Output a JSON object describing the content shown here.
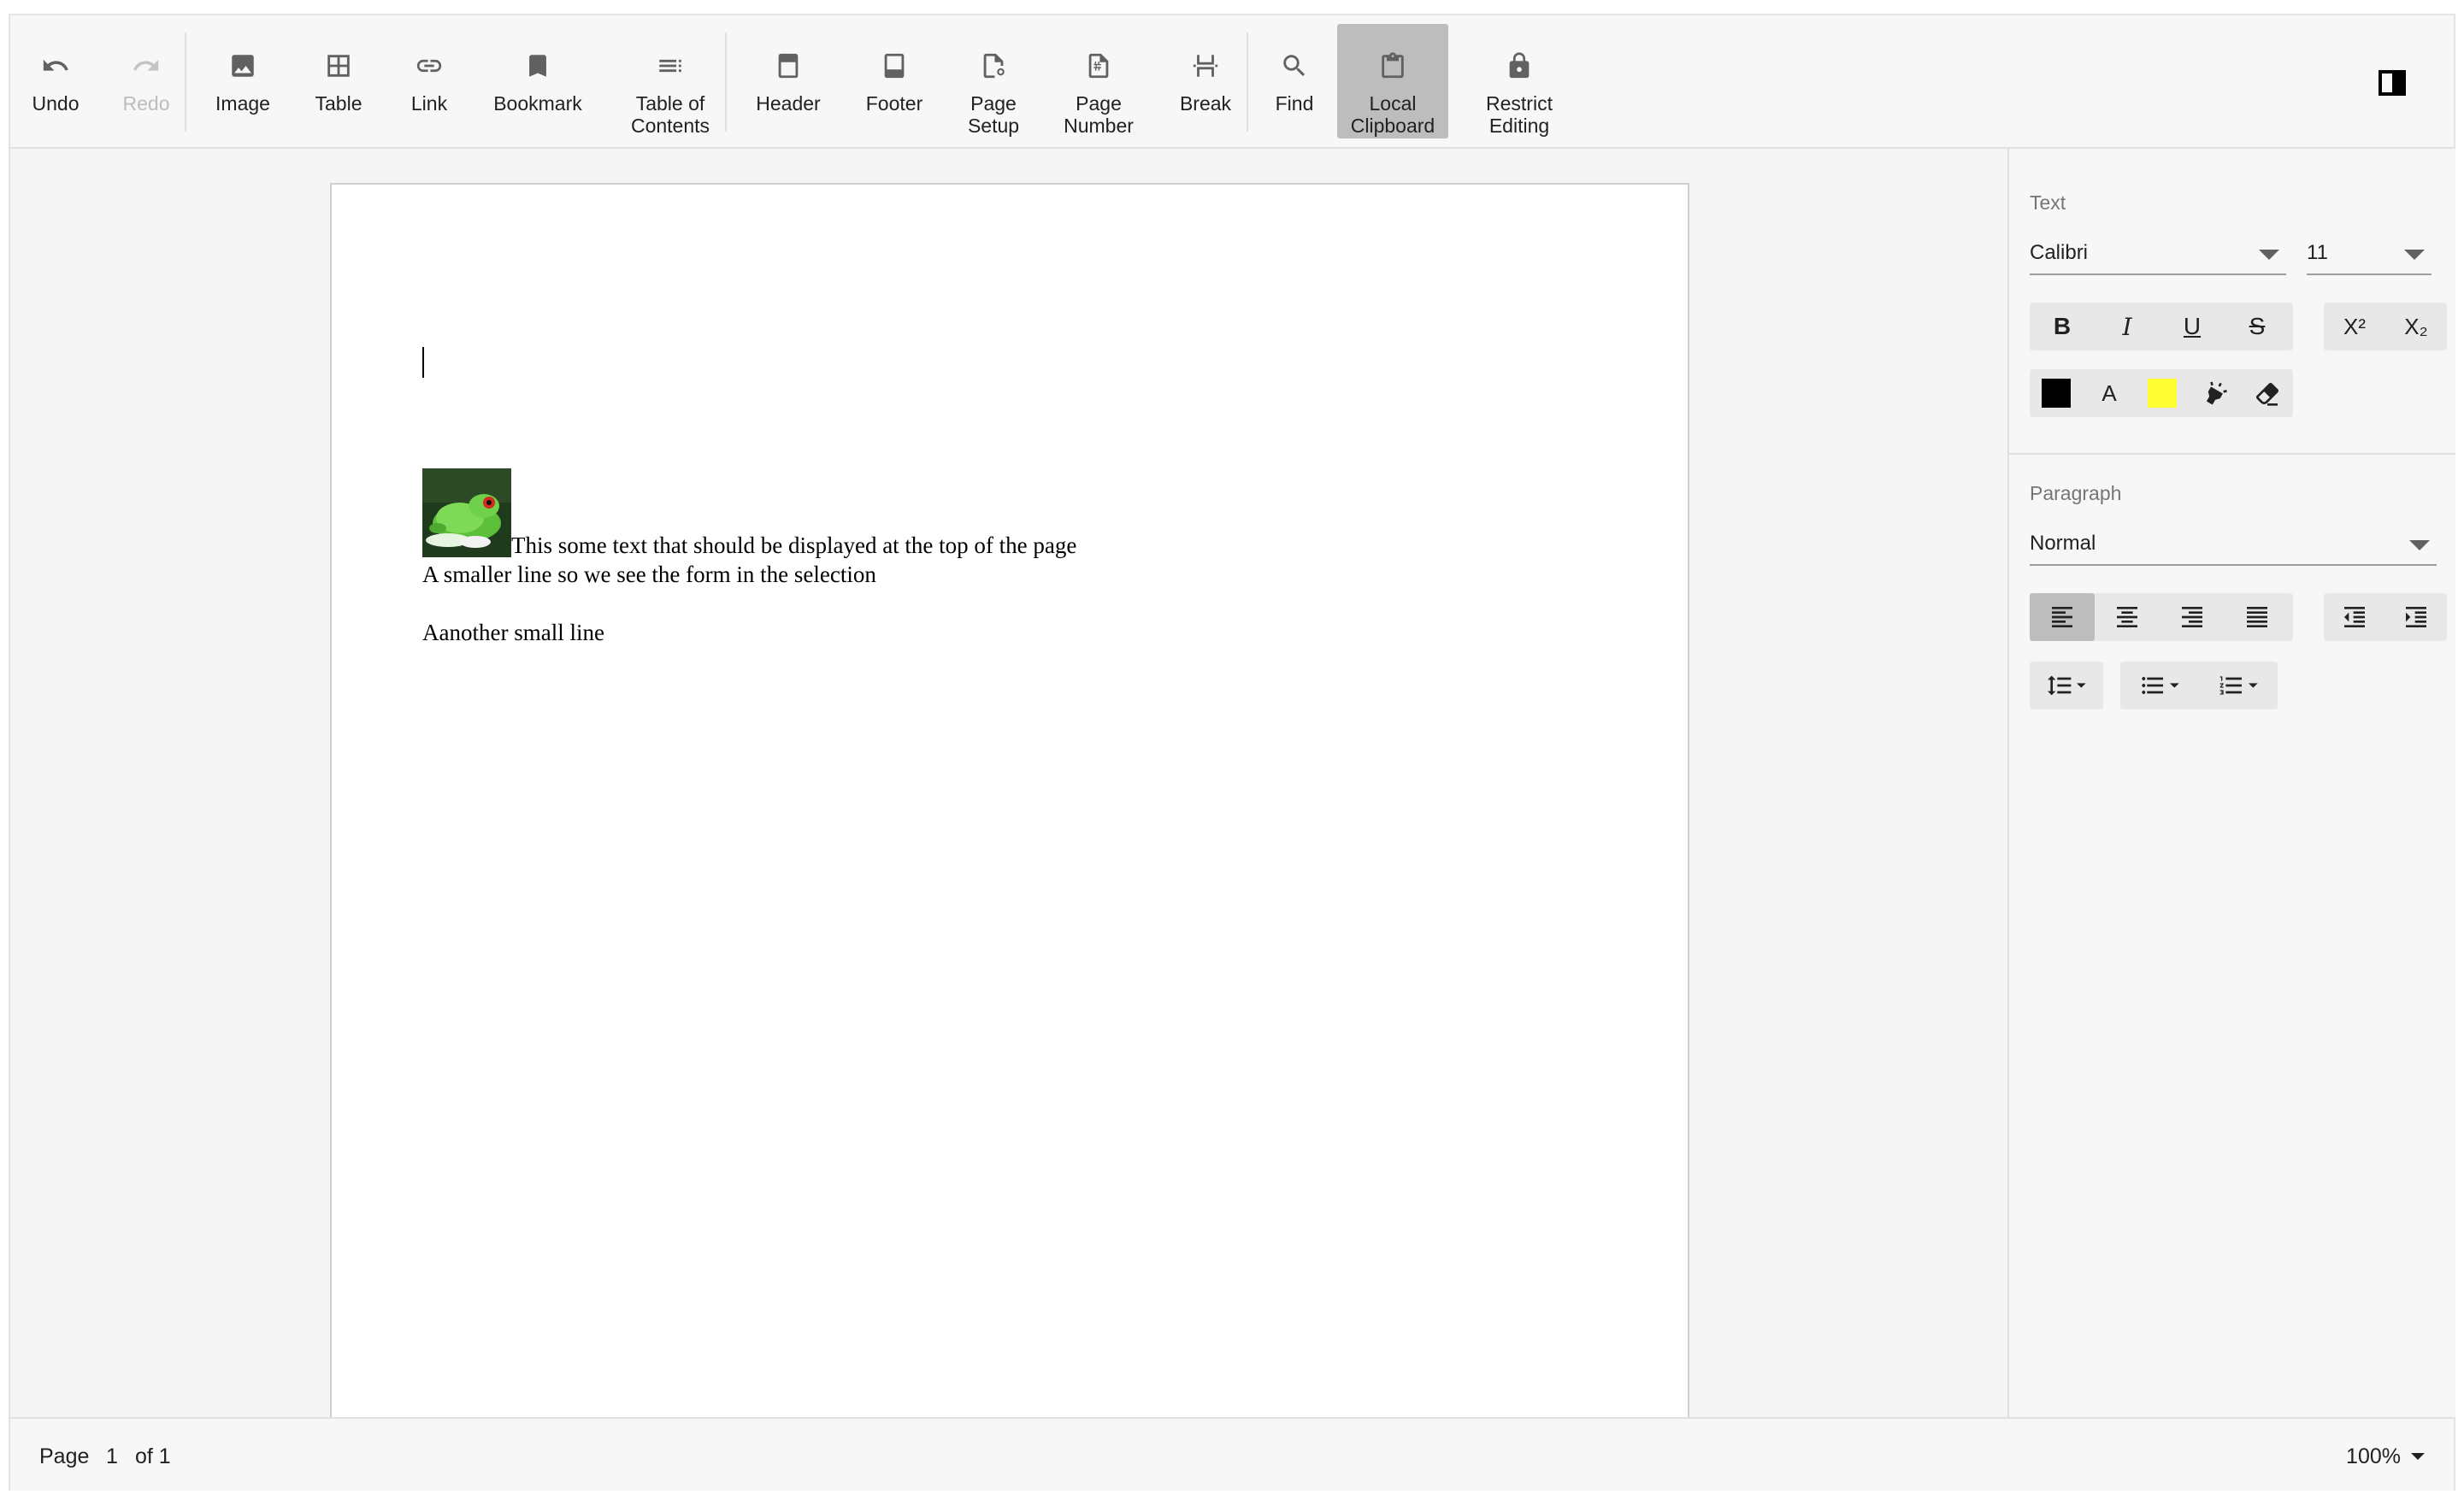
{
  "toolbar": {
    "undo": "Undo",
    "redo": "Redo",
    "image": "Image",
    "table": "Table",
    "link": "Link",
    "bookmark": "Bookmark",
    "toc": "Table of\nContents",
    "header": "Header",
    "footer": "Footer",
    "page_setup": "Page\nSetup",
    "page_number": "Page\nNumber",
    "break": "Break",
    "find": "Find",
    "local_clipboard": "Local\nClipboard",
    "restrict_editing": "Restrict\nEditing"
  },
  "document": {
    "line1": "This some text that should be displayed at the top of the page",
    "line2": "A smaller line so we see the form in the selection",
    "line3": "Aanother small line"
  },
  "properties": {
    "text_section": "Text",
    "font_family": "Calibri",
    "font_size": "11",
    "bold": "B",
    "italic": "I",
    "underline": "U",
    "strike": "S",
    "superscript": "X²",
    "subscript": "X₂",
    "font_color": "#000000",
    "highlight_color": "#ffff33",
    "font_color_glyph": "A",
    "paragraph_section": "Paragraph",
    "style": "Normal"
  },
  "status": {
    "page_label": "Page",
    "current_page": "1",
    "of_label": "of 1",
    "zoom": "100%"
  },
  "colors": {
    "toolbar_bg": "#f7f7f7",
    "active_bg": "#bdbdbd",
    "pane_bg": "#f7f7f7"
  }
}
